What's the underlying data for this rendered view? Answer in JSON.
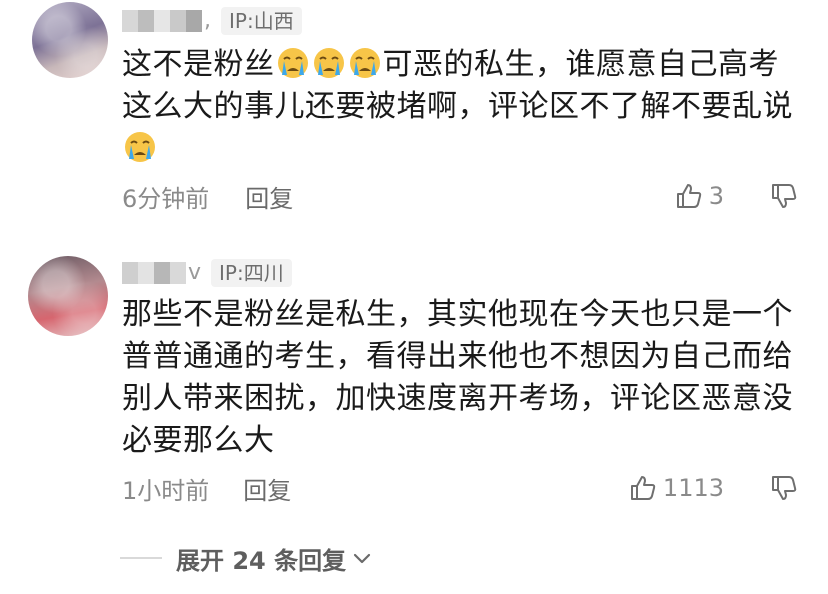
{
  "comments": [
    {
      "username_tail": ",",
      "ip": "IP:山西",
      "text_parts": [
        "这不是粉丝",
        "可恶的私生，谁愿意自己高考这么大的事儿还要被堵啊，评论区不了解不要乱说"
      ],
      "emoji_icon": "crying-face-icon",
      "time": "6分钟前",
      "reply_label": "回复",
      "likes": "3"
    },
    {
      "username_tail": "v",
      "ip": "IP:四川",
      "text": "那些不是粉丝是私生，其实他现在今天也只是一个普普通通的考生，看得出来他也不想因为自己而给别人带来困扰，加快速度离开考场，评论区恶意没必要那么大",
      "time": "1小时前",
      "reply_label": "回复",
      "likes": "1113"
    }
  ],
  "expand_replies": {
    "label": "展开 24 条回复"
  },
  "colors": {
    "text": "#1a1a1a",
    "meta": "#8a8a8a",
    "ip_badge_bg": "#f2f2f2",
    "emoji_yellow": "#f7c548",
    "emoji_tears": "#3ea8ea"
  }
}
